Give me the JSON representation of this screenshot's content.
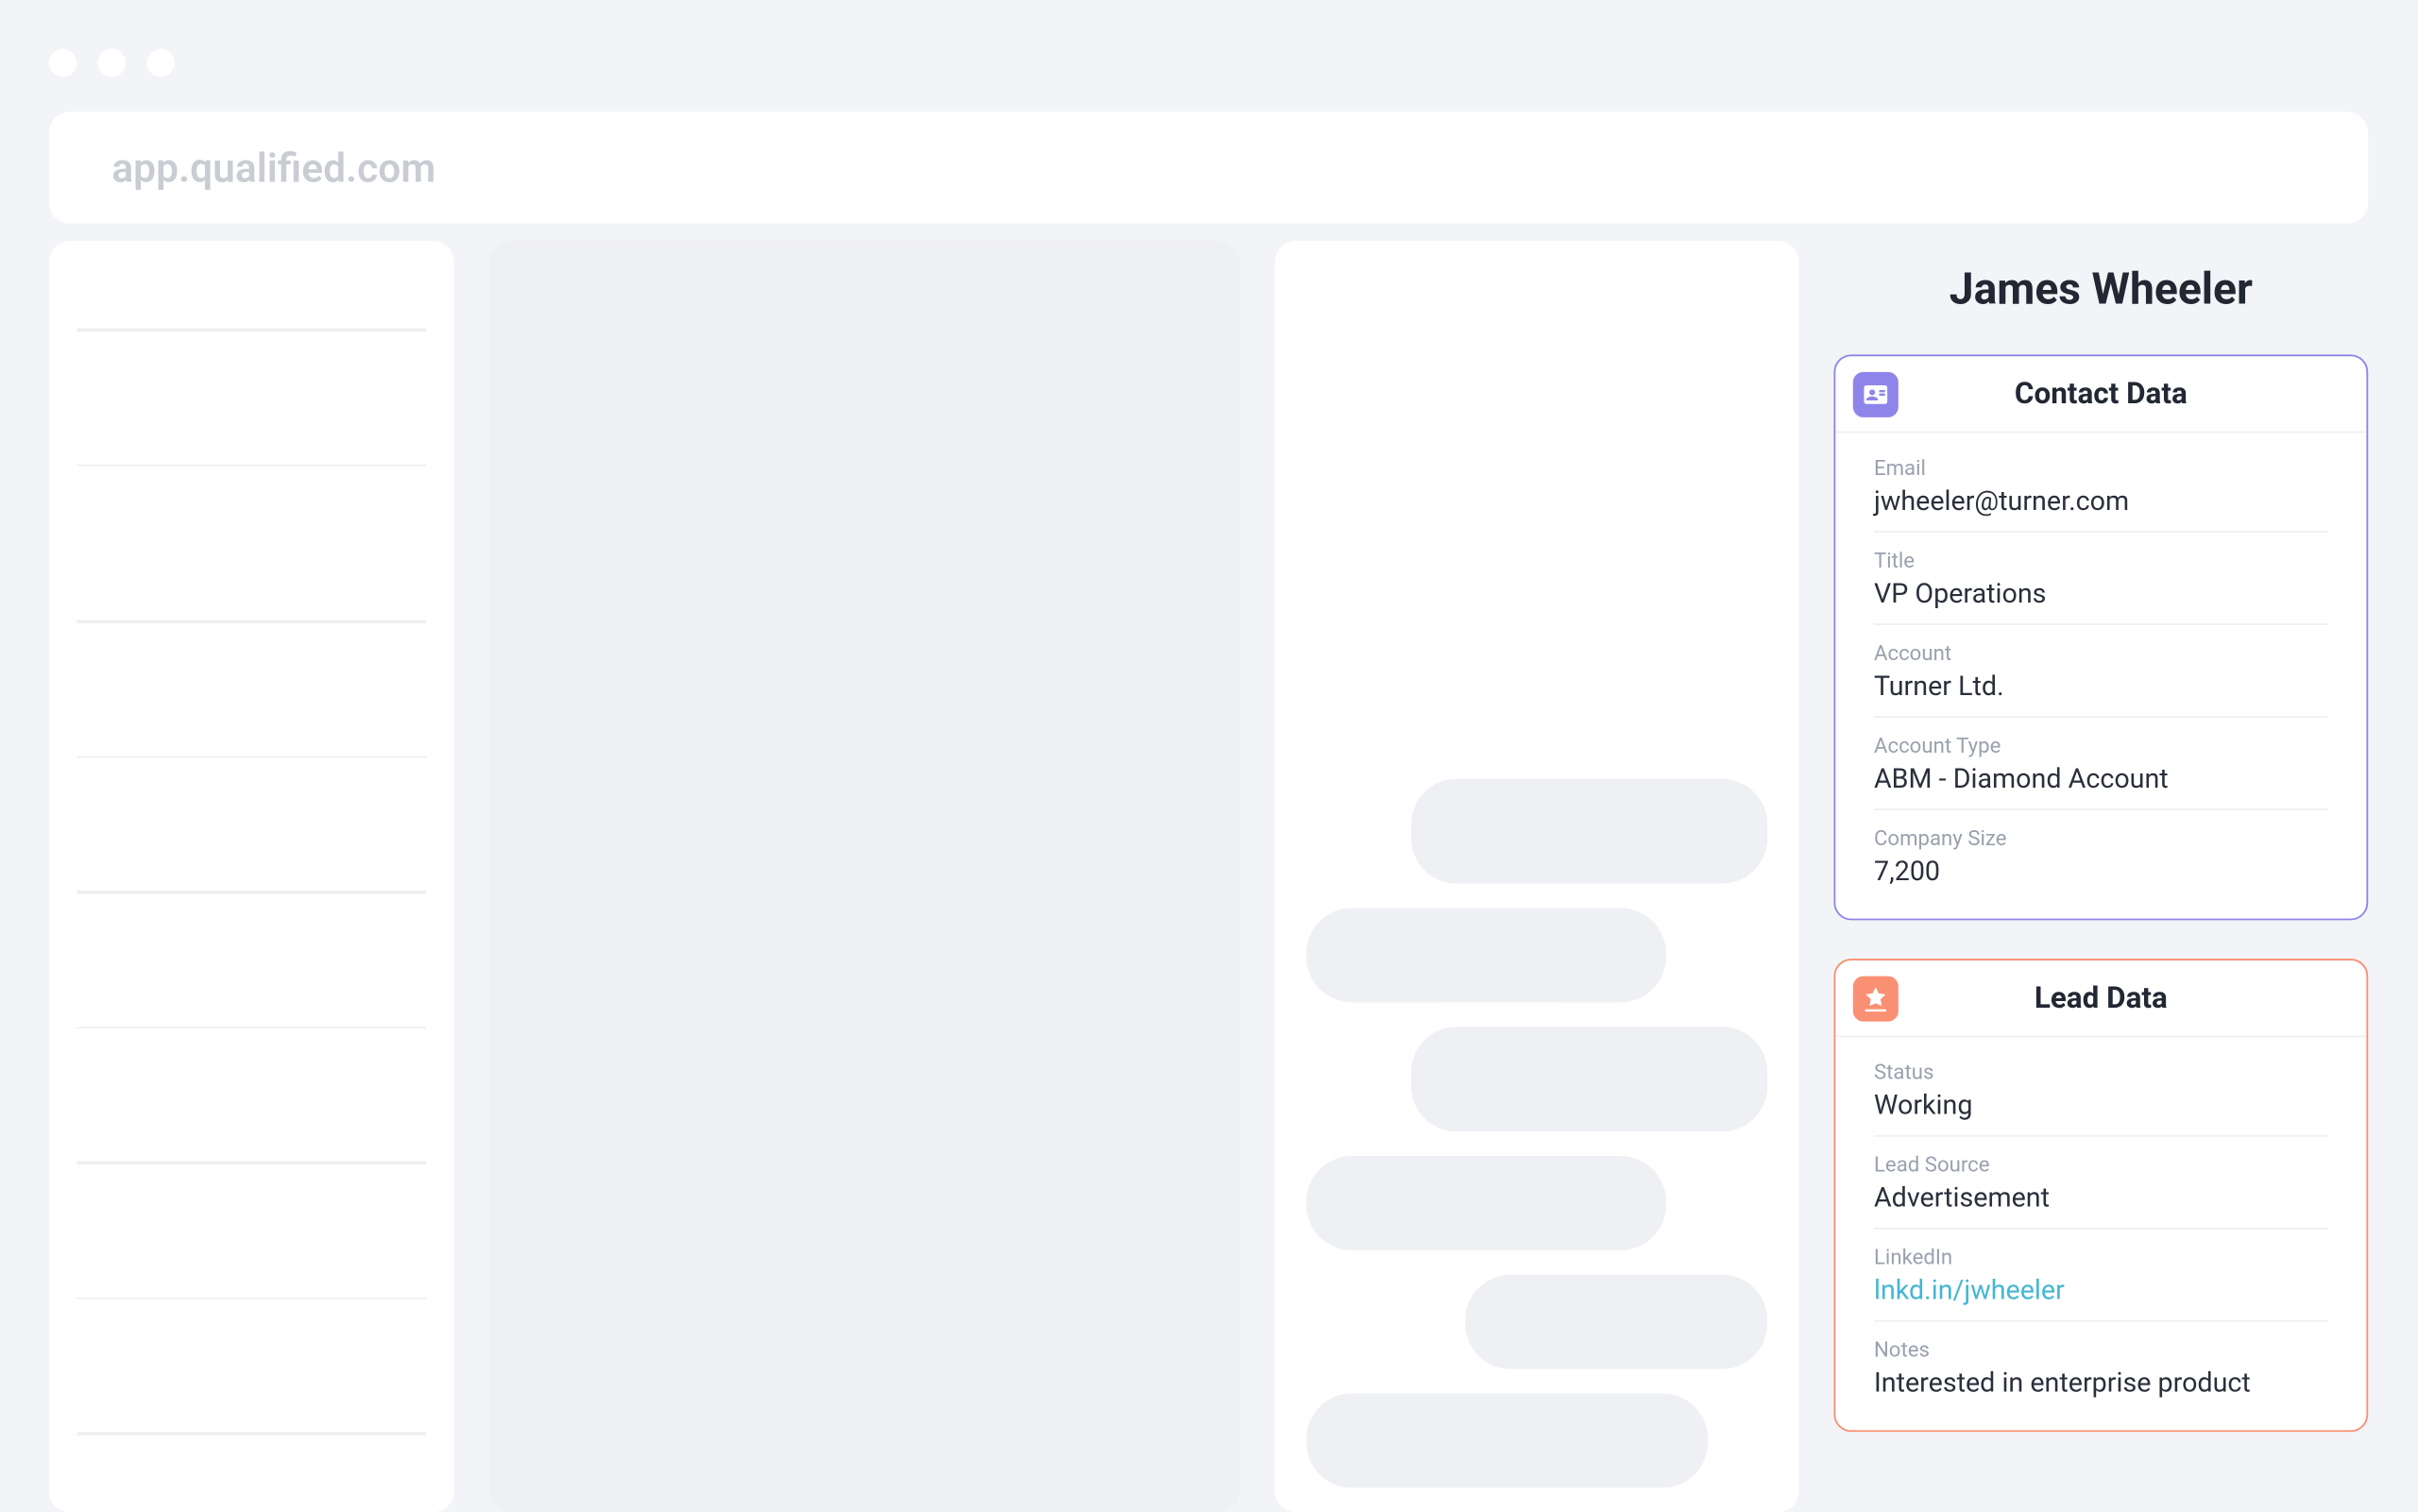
{
  "url_bar": "app.qualified.com",
  "visitor_name": "James Wheeler",
  "contact_card": {
    "title": "Contact Data",
    "fields": [
      {
        "label": "Email",
        "value": "jwheeler@turner.com"
      },
      {
        "label": "Title",
        "value": "VP Operations"
      },
      {
        "label": "Account",
        "value": "Turner Ltd."
      },
      {
        "label": "Account Type",
        "value": "ABM - Diamond Account"
      },
      {
        "label": "Company Size",
        "value": "7,200"
      }
    ]
  },
  "lead_card": {
    "title": "Lead Data",
    "fields": [
      {
        "label": "Status",
        "value": "Working"
      },
      {
        "label": "Lead Source",
        "value": "Advertisement"
      },
      {
        "label": "LinkedIn",
        "value": "lnkd.in/jwheeler",
        "link": true
      },
      {
        "label": "Notes",
        "value": "Interested in enterprise product"
      }
    ]
  }
}
